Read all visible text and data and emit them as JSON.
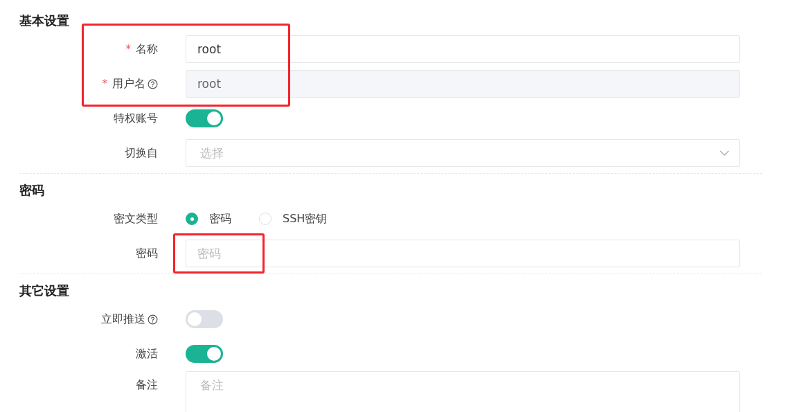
{
  "sections": [
    {
      "title": "基本设置",
      "rows": [
        {
          "kind": "text",
          "label": "名称",
          "required_mark": "*",
          "value": "root",
          "label_annotated": true,
          "value_annotated": true
        },
        {
          "kind": "text",
          "label": "用户名",
          "required_mark": "*",
          "help": true,
          "value": "root",
          "disabled": true,
          "label_annotated": true,
          "value_annotated": true
        },
        {
          "kind": "switch",
          "label": "特权账号",
          "on": true
        },
        {
          "kind": "select",
          "label": "切换自",
          "placeholder": "选择"
        }
      ]
    },
    {
      "title": "密码",
      "rows": [
        {
          "kind": "radio",
          "label": "密文类型",
          "options": [
            {
              "label": "密码",
              "selected": true
            },
            {
              "label": "SSH密钥",
              "selected": false
            }
          ]
        },
        {
          "kind": "text",
          "label": "密码",
          "placeholder": "密码",
          "value_annotated": true
        }
      ]
    },
    {
      "title": "其它设置",
      "rows": [
        {
          "kind": "switch",
          "label": "立即推送",
          "help": true,
          "on": false
        },
        {
          "kind": "switch",
          "label": "激活",
          "on": true
        },
        {
          "kind": "textarea",
          "label": "备注",
          "placeholder": "备注"
        }
      ]
    }
  ]
}
